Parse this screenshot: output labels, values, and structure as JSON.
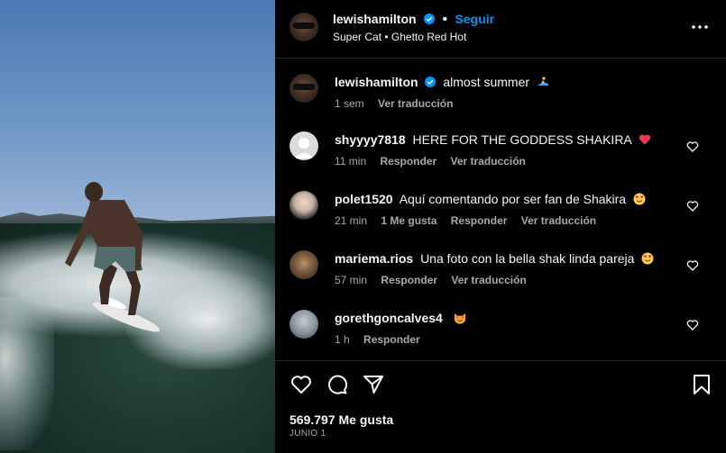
{
  "post": {
    "author": "lewishamilton",
    "follow_label": "Seguir",
    "song": "Super Cat • Ghetto Red Hot",
    "caption_user": "lewishamilton",
    "caption_text": "almost summer",
    "caption_time": "1 sem",
    "caption_translate": "Ver traducción"
  },
  "comments": [
    {
      "user": "shyyyy7818",
      "text": "HERE FOR THE GODDESS SHAKIRA",
      "time": "11 min",
      "likes": "",
      "reply": "Responder",
      "translate": "Ver traducción",
      "emoji": "red-heart"
    },
    {
      "user": "polet1520",
      "text": "Aquí comentando por ser fan de Shakira",
      "time": "21 min",
      "likes": "1 Me gusta",
      "reply": "Responder",
      "translate": "Ver traducción",
      "emoji": "heart-eyes"
    },
    {
      "user": "mariema.rios",
      "text": "Una foto con la bella shak linda pareja",
      "time": "57 min",
      "likes": "",
      "reply": "Responder",
      "translate": "Ver traducción",
      "emoji": "heart-eyes"
    },
    {
      "user": "gorethgoncalves4",
      "text": "",
      "time": "1 h",
      "likes": "",
      "reply": "Responder",
      "translate": "",
      "emoji": "heart-eyes-cat"
    }
  ],
  "footer": {
    "likes": "569.797 Me gusta",
    "date": "JUNIO 1"
  },
  "colors": {
    "accent": "#0095f6",
    "background": "#000000",
    "muted": "#a8a8a8"
  }
}
